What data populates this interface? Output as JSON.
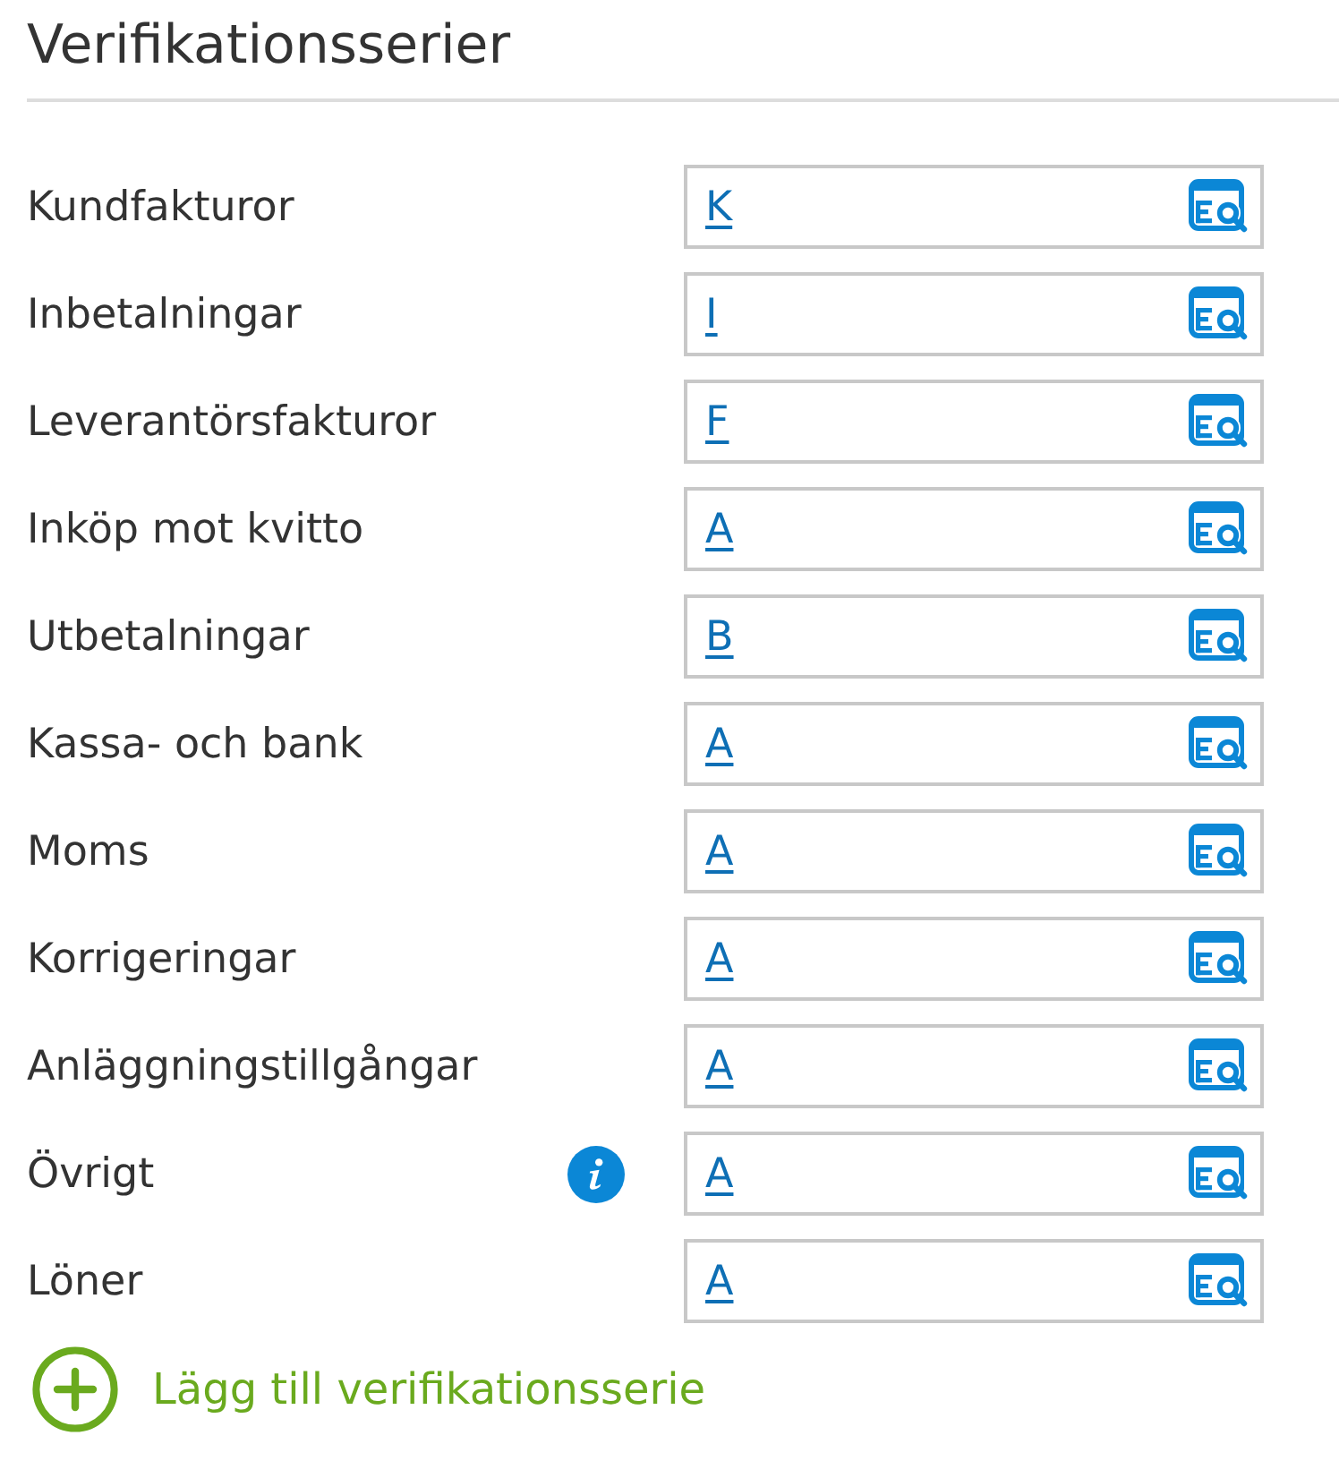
{
  "title": "Verifikationsserier",
  "rows": [
    {
      "label": "Kundfakturor",
      "value": "K",
      "info": false
    },
    {
      "label": "Inbetalningar",
      "value": "I",
      "info": false
    },
    {
      "label": "Leverantörsfakturor",
      "value": "F",
      "info": false
    },
    {
      "label": "Inköp mot kvitto",
      "value": "A",
      "info": false
    },
    {
      "label": "Utbetalningar",
      "value": "B",
      "info": false
    },
    {
      "label": "Kassa- och bank",
      "value": "A",
      "info": false
    },
    {
      "label": "Moms",
      "value": "A",
      "info": false
    },
    {
      "label": "Korrigeringar",
      "value": "A",
      "info": false
    },
    {
      "label": "Anläggningstillgångar",
      "value": "A",
      "info": false
    },
    {
      "label": "Övrigt",
      "value": "A",
      "info": true
    },
    {
      "label": "Löner",
      "value": "A",
      "info": false
    }
  ],
  "add_button": {
    "label": "Lägg till verifikationsserie"
  }
}
